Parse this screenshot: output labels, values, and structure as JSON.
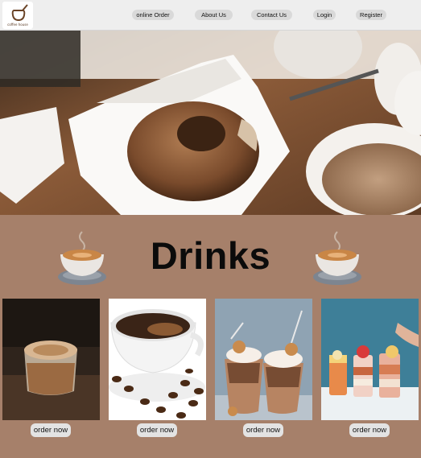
{
  "brand": {
    "logo_text": "coffee house",
    "icon": "coffee-pot-logo"
  },
  "nav": {
    "items": [
      {
        "label": "online Order"
      },
      {
        "label": "About Us"
      },
      {
        "label": "Contact Us"
      },
      {
        "label": "Login"
      },
      {
        "label": "Register"
      }
    ]
  },
  "hero": {
    "image": "donut-and-coffee-photo"
  },
  "drinks": {
    "title": "Drinks",
    "cards": [
      {
        "image": "latte-glass-photo",
        "button": "order now"
      },
      {
        "image": "black-coffee-cup-photo",
        "button": "order now"
      },
      {
        "image": "chocolate-frappe-photo",
        "button": "order now"
      },
      {
        "image": "layered-milkshakes-photo",
        "button": "order now"
      }
    ]
  },
  "colors": {
    "page_background": "#a6806a",
    "navbar": "#eeeeee",
    "button": "#e3e3e3"
  }
}
